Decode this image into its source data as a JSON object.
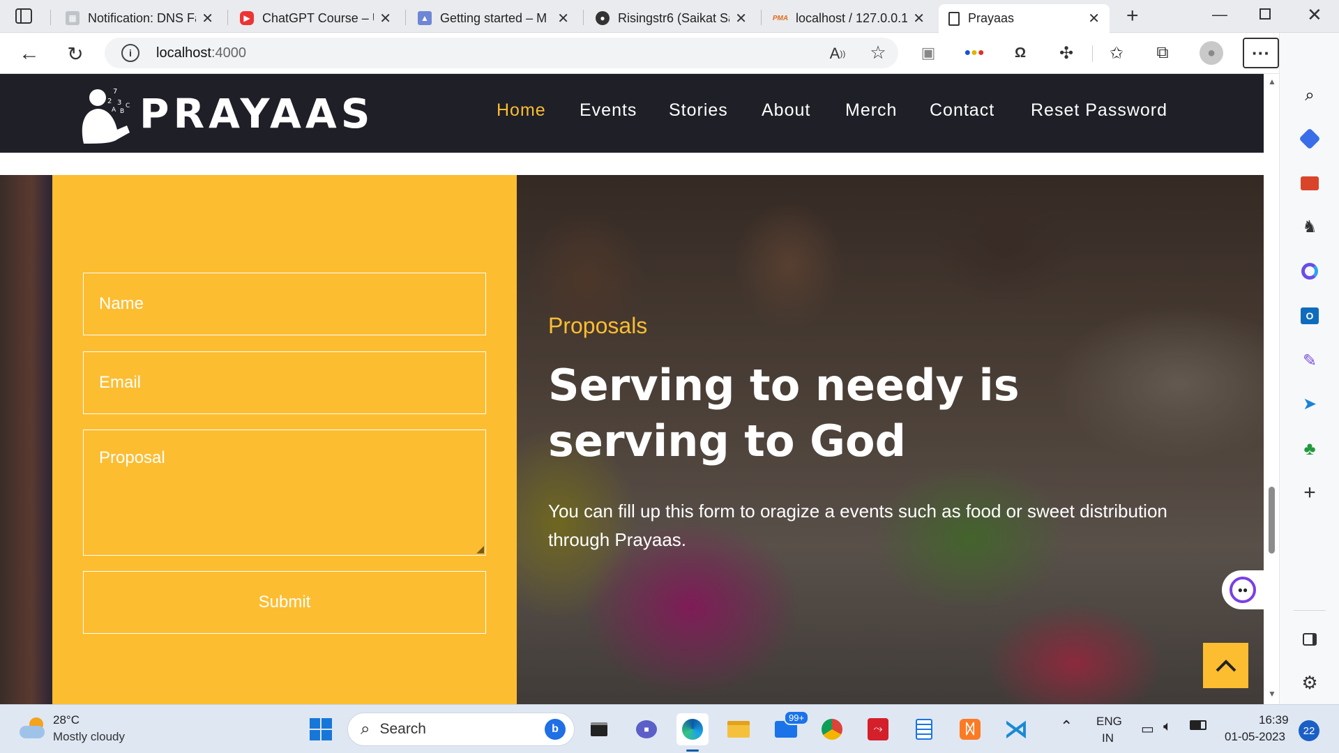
{
  "browser": {
    "tabs": [
      {
        "title": "Notification: DNS Fa",
        "icon": "notification-tab-icon"
      },
      {
        "title": "ChatGPT Course – U",
        "icon": "youtube-icon"
      },
      {
        "title": "Getting started – M",
        "icon": "graduation-cap-icon"
      },
      {
        "title": "Risingstr6 (Saikat Sa",
        "icon": "github-icon"
      },
      {
        "title": "localhost / 127.0.0.1",
        "icon": "phpmyadmin-icon",
        "badge": "PMA"
      },
      {
        "title": "Prayaas",
        "icon": "page-icon"
      }
    ],
    "url_host": "localhost",
    "url_port": ":4000"
  },
  "site": {
    "brand": "PRAYAAS",
    "nav": [
      "Home",
      "Events",
      "Stories",
      "About",
      "Merch",
      "Contact",
      "Reset Password"
    ],
    "active_nav": "Home",
    "form": {
      "name_placeholder": "Name",
      "email_placeholder": "Email",
      "proposal_placeholder": "Proposal",
      "submit_label": "Submit"
    },
    "hero": {
      "kicker": "Proposals",
      "title": "Serving to needy is serving to God",
      "text": "You can fill up this form to oragize a events such as food or sweet distribution through Prayaas."
    }
  },
  "taskbar": {
    "weather_temp": "28°C",
    "weather_desc": "Mostly cloudy",
    "search_label": "Search",
    "mail_badge": "99+",
    "lang_top": "ENG",
    "lang_bottom": "IN",
    "time": "16:39",
    "date": "01-05-2023",
    "notif_count": "22"
  },
  "colors": {
    "accent": "#fcbd31",
    "nav_bg": "#1f1f28"
  }
}
